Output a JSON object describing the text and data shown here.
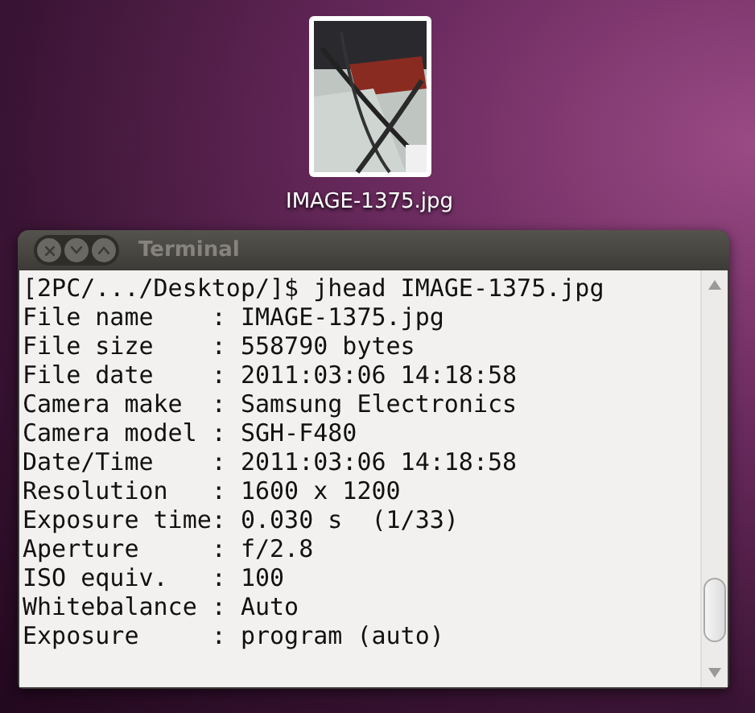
{
  "desktop_icon": {
    "label": "IMAGE-1375.jpg",
    "kind": "picture"
  },
  "terminal": {
    "title": "Terminal",
    "prompt": "[2PC/.../Desktop/]$ jhead IMAGE-1375.jpg",
    "lines": [
      "File name    : IMAGE-1375.jpg",
      "File size    : 558790 bytes",
      "File date    : 2011:03:06 14:18:58",
      "Camera make  : Samsung Electronics",
      "Camera model : SGH-F480",
      "Date/Time    : 2011:03:06 14:18:58",
      "Resolution   : 1600 x 1200",
      "Exposure time: 0.030 s  (1/33)",
      "Aperture     : f/2.8",
      "ISO equiv.   : 100",
      "Whitebalance : Auto",
      "Exposure     : program (auto)"
    ]
  }
}
